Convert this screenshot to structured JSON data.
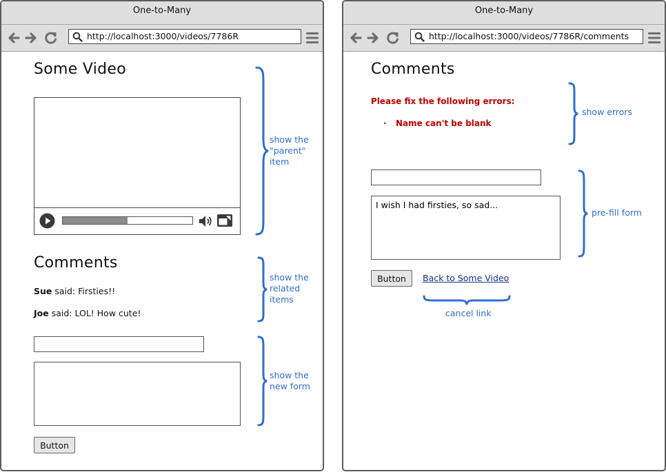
{
  "colors": {
    "annotation": "#2f6dd0",
    "error": "#c00000",
    "link": "#17338a",
    "chrome": "#dfdfdf"
  },
  "left": {
    "window_title": "One-to-Many",
    "url": "http://localhost:3000/videos/7786R",
    "page_title": "Some Video",
    "video": {
      "progress_fraction": 0.5
    },
    "comments_heading": "Comments",
    "comments": [
      {
        "author": "Sue",
        "text": " said: Firsties!!"
      },
      {
        "author": "Joe",
        "text": " said: LOL!  How cute!"
      }
    ],
    "form": {
      "name_value": "",
      "body_value": "",
      "button_label": "Button"
    },
    "annotations": {
      "parent": [
        "show the",
        "\"parent\"",
        "item"
      ],
      "related": [
        "show the",
        "related",
        "items"
      ],
      "new_form": [
        "show the",
        "new form"
      ]
    }
  },
  "right": {
    "window_title": "One-to-Many",
    "url": "http://localhost:3000/videos/7786R/comments",
    "page_title": "Comments",
    "errors": {
      "title": "Please fix the following errors:",
      "items": [
        "Name can't be blank"
      ]
    },
    "form": {
      "name_value": "",
      "body_value": "I wish I had firsties, so sad...",
      "button_label": "Button"
    },
    "back_link": "Back to Some Video",
    "annotations": {
      "errors": "show errors",
      "prefill": "pre-fill form",
      "cancel": "cancel link"
    }
  }
}
